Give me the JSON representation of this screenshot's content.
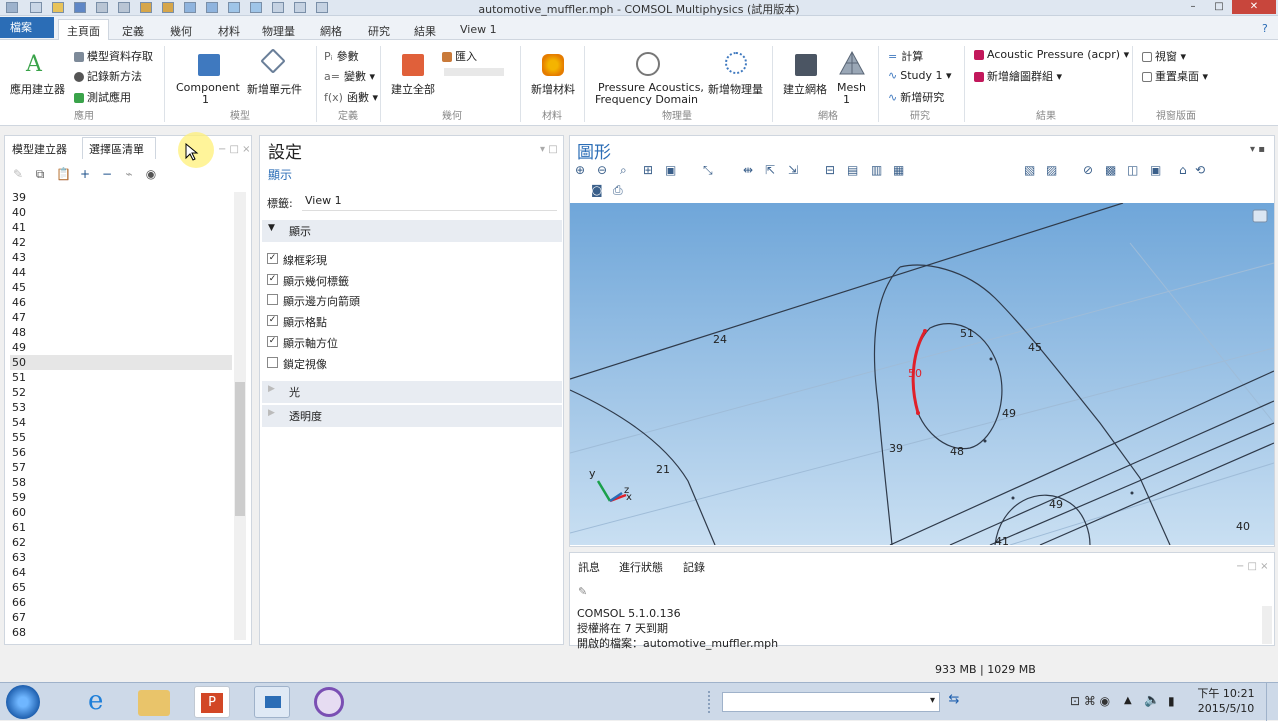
{
  "window": {
    "title": "automotive_muffler.mph - COMSOL Multiphysics (試用版本)"
  },
  "ribbon_tabs": {
    "file": "檔案",
    "tabs": [
      "主頁面",
      "定義",
      "幾何",
      "材料",
      "物理量",
      "網格",
      "研究",
      "結果",
      "View 1"
    ]
  },
  "ribbon": {
    "app_builder": "應用建立器",
    "model_data_access": "模型資料存取",
    "record_method": "記錄新方法",
    "test_app": "測試應用",
    "group_app": "應用",
    "component": "Component",
    "component_num": "1",
    "add_component": "新增單元件",
    "group_model": "模型",
    "parameters": "參數",
    "variables": "變數",
    "functions": "函數",
    "group_definitions": "定義",
    "build_all": "建立全部",
    "import": "匯入",
    "group_geometry": "幾何",
    "add_material": "新增材料",
    "group_materials": "材料",
    "physics_line1": "Pressure Acoustics,",
    "physics_line2": "Frequency Domain",
    "add_physics": "新增物理量",
    "group_physics": "物理量",
    "build_mesh": "建立網格",
    "mesh": "Mesh",
    "mesh_num": "1",
    "group_mesh": "網格",
    "compute": "計算",
    "study1": "Study 1",
    "add_study": "新增研究",
    "group_study": "研究",
    "acoustic_pressure": "Acoustic Pressure (acpr)",
    "add_plot_group": "新增繪圖群組",
    "group_results": "結果",
    "windows": "視窗",
    "reset_desktop": "重置桌面",
    "group_layout": "視窗版面"
  },
  "left_panel": {
    "tab_model_builder": "模型建立器",
    "tab_selection_list": "選擇區清單",
    "items": [
      "39",
      "40",
      "41",
      "42",
      "43",
      "44",
      "45",
      "46",
      "47",
      "48",
      "49",
      "50",
      "51",
      "52",
      "53",
      "54",
      "55",
      "56",
      "57",
      "58",
      "59",
      "60",
      "61",
      "62",
      "63",
      "64",
      "65",
      "66",
      "67",
      "68"
    ],
    "selected": "50"
  },
  "settings": {
    "title": "設定",
    "subtitle": "顯示",
    "label_caption": "標籤:",
    "label_value": "View 1",
    "section_display": "顯示",
    "options": [
      {
        "label": "線框彩現",
        "checked": true
      },
      {
        "label": "顯示幾何標籤",
        "checked": true
      },
      {
        "label": "顯示邊方向箭頭",
        "checked": false
      },
      {
        "label": "顯示格點",
        "checked": true
      },
      {
        "label": "顯示軸方位",
        "checked": true
      },
      {
        "label": "鎖定視像",
        "checked": false
      }
    ],
    "section_light": "光",
    "section_transparency": "透明度"
  },
  "graphics": {
    "title": "圖形",
    "labels": {
      "e24": "24",
      "e21": "21",
      "e51": "51",
      "e45": "45",
      "e50": "50",
      "e49a": "49",
      "e39": "39",
      "e48": "48",
      "e49b": "49",
      "e41": "41",
      "e40": "40"
    },
    "axis": {
      "x": "x",
      "y": "y",
      "z": "z"
    },
    "bg_top": "#6fa6d9",
    "bg_bottom": "#c9dff2",
    "highlight": "#e0202a"
  },
  "messages": {
    "tabs": [
      "訊息",
      "進行狀態",
      "記錄"
    ],
    "lines": [
      "COMSOL 5.1.0.136",
      "授權將在 7 天到期",
      "開啟的檔案：automotive_muffler.mph"
    ]
  },
  "status": {
    "memory": "933 MB | 1029 MB"
  },
  "taskbar": {
    "time": "下午 10:21",
    "date": "2015/5/10"
  }
}
